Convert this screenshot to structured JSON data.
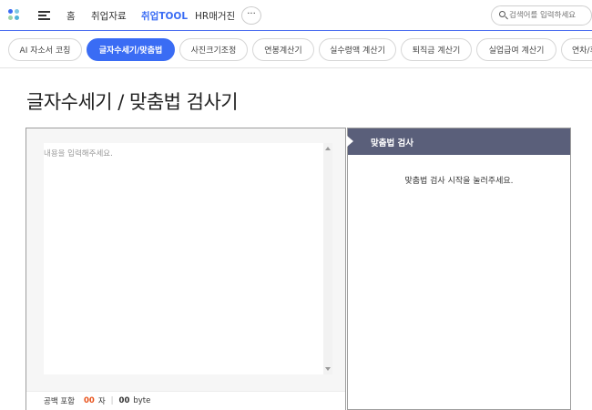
{
  "nav": {
    "items": [
      {
        "label": "홈"
      },
      {
        "label": "취업자료"
      },
      {
        "label_prefix": "취업",
        "label_suffix": "TOOL"
      },
      {
        "label": "HR매거진"
      }
    ],
    "more_label": "···",
    "search_placeholder": "검색어를 입력하세요"
  },
  "tools": [
    {
      "label": "AI 자소서 코칭"
    },
    {
      "label": "글자수세기/맞춤법"
    },
    {
      "label": "사진크기조정"
    },
    {
      "label": "연봉계산기"
    },
    {
      "label": "실수령액 계산기"
    },
    {
      "label": "퇴직금 계산기"
    },
    {
      "label": "실업급여 계산기"
    },
    {
      "label": "연차/휴가"
    }
  ],
  "page_title": "글자수세기 / 맞춤법 검사기",
  "editor": {
    "placeholder": "내용을 입력해주세요.",
    "count_label": "공백 포함",
    "char_count": "00",
    "char_unit": "자",
    "separator": "|",
    "byte_count": "00",
    "byte_unit": "byte"
  },
  "result": {
    "header": "맞춤법 검사",
    "message": "맞춤법 검사 시작을 눌러주세요."
  },
  "colors": {
    "accent": "#3a6cf4",
    "header_bg": "#5a5f7a",
    "count_highlight": "#e8531c"
  }
}
